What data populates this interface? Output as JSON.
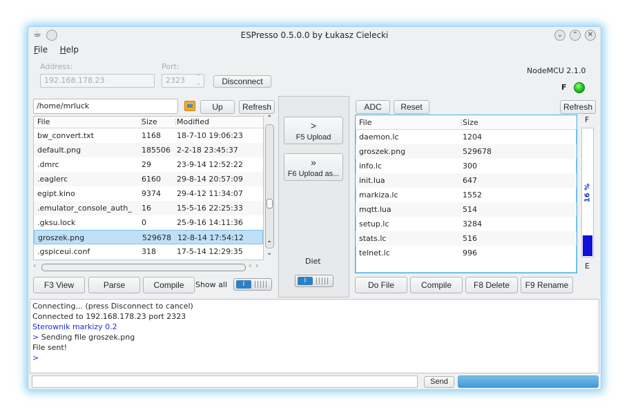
{
  "window": {
    "title": "ESPresso 0.5.0.0 by Łukasz Cielecki",
    "left_icon_1": "coffee-cup-icon",
    "left_icon_2": "circle-icon",
    "controls": [
      "minimize-icon",
      "maximize-icon",
      "close-icon"
    ]
  },
  "menu": [
    {
      "label_u": "F",
      "label_rest": "ile"
    },
    {
      "label_u": "H",
      "label_rest": "elp"
    }
  ],
  "connection": {
    "address_label": "Address:",
    "address_value": "192.168.178.23",
    "port_label": "Port:",
    "port_value": "2323",
    "disconnect_label": "Disconnect",
    "firmware": "NodeMCU 2.1.0",
    "led_label": "F",
    "led_color": "#18c21a"
  },
  "local": {
    "path": "/home/mrluck",
    "up_label": "Up",
    "refresh_label": "Refresh",
    "folder_icon": "folder-icon",
    "columns": [
      "File",
      "Size",
      "Modified"
    ],
    "rows": [
      {
        "name": "bw_convert.txt",
        "size": "1168",
        "modified": "18-7-10 19:06:23"
      },
      {
        "name": "default.png",
        "size": "185506",
        "modified": "2-2-18 23:45:37"
      },
      {
        "name": ".dmrc",
        "size": "29",
        "modified": "23-9-14 12:52:22"
      },
      {
        "name": ".eaglerc",
        "size": "6160",
        "modified": "29-8-14 20:57:09"
      },
      {
        "name": "egipt.kino",
        "size": "9374",
        "modified": "29-4-12 11:34:07"
      },
      {
        "name": ".emulator_console_auth_",
        "size": "16",
        "modified": "15-5-16 22:25:33"
      },
      {
        "name": ".gksu.lock",
        "size": "0",
        "modified": "25-9-16 14:11:36"
      },
      {
        "name": "groszek.png",
        "size": "529678",
        "modified": "12-8-14 17:54:12"
      },
      {
        "name": ".gspiceui.conf",
        "size": "318",
        "modified": "17-5-14 12:29:35"
      }
    ],
    "selected_index": 7,
    "f3_label": "F3 View",
    "parse_label": "Parse",
    "compile_label": "Compile",
    "show_all_label": "Show all"
  },
  "center": {
    "upload_arrow": ">",
    "upload_label": "F5 Upload",
    "upload_as_arrow": "»",
    "upload_as_label": "F6 Upload as...",
    "diet_label": "Diet"
  },
  "remote": {
    "adc_label": "ADC",
    "reset_label": "Reset",
    "refresh_label": "Refresh",
    "columns": [
      "File",
      "Size"
    ],
    "rows": [
      {
        "name": "daemon.lc",
        "size": "1204"
      },
      {
        "name": "groszek.png",
        "size": "529678"
      },
      {
        "name": "info.lc",
        "size": "300"
      },
      {
        "name": "init.lua",
        "size": "647"
      },
      {
        "name": "markiza.lc",
        "size": "1552"
      },
      {
        "name": "mqtt.lua",
        "size": "514"
      },
      {
        "name": "setup.lc",
        "size": "3284"
      },
      {
        "name": "stats.lc",
        "size": "516"
      },
      {
        "name": "telnet.lc",
        "size": "996"
      }
    ],
    "do_file_label": "Do File",
    "compile_label": "Compile",
    "delete_label": "F8 Delete",
    "rename_label": "F9 Rename"
  },
  "storage": {
    "top_label": "F",
    "bottom_label": "E",
    "percent_text": "16 %",
    "percent": 16,
    "fill_color": "#1010d8"
  },
  "log": [
    {
      "text": "Connecting... (press Disconnect to cancel)",
      "color": "black"
    },
    {
      "text": "Connected to 192.168.178.23 port 2323",
      "color": "black"
    },
    {
      "text": "Sterownik markizy 0.2",
      "color": "blue"
    },
    {
      "text": "> Sending file groszek.png",
      "color": "mixed"
    },
    {
      "text": "File sent!",
      "color": "black"
    },
    {
      "text": ">",
      "color": "blue"
    }
  ],
  "command": {
    "value": "",
    "send_label": "Send",
    "progress": 100
  }
}
